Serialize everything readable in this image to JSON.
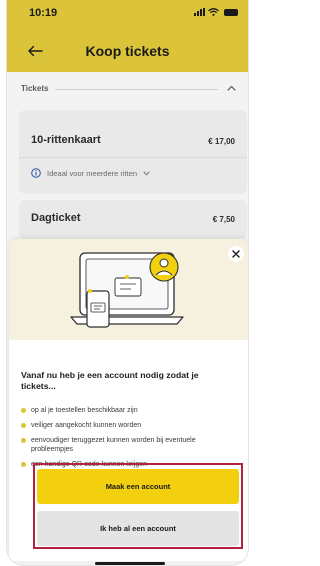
{
  "status_bar": {
    "time": "10:19"
  },
  "header": {
    "title": "Koop tickets"
  },
  "section": {
    "label": "Tickets"
  },
  "tickets": [
    {
      "name": "10-rittenkaart",
      "price": "€ 17,00",
      "info": "Ideaal voor meerdere ritten"
    },
    {
      "name": "Dagticket",
      "price": "€ 7,50"
    }
  ],
  "modal": {
    "heading": "Vanaf nu heb je een account nodig zodat je tickets...",
    "benefits": [
      "op al je toestellen beschikbaar zijn",
      "veiliger aangekocht kunnen worden",
      "eenvoudiger teruggezet kunnen worden bij eventuele probleempjes",
      "een handige QR-code kunnen krijgen"
    ],
    "primary_button": "Maak een account",
    "secondary_button": "Ik heb al een account"
  },
  "colors": {
    "brand_yellow": "#f2d00f",
    "header_yellow": "#dcc43a",
    "highlight_red": "#b42040"
  },
  "icons": [
    "back-arrow-icon",
    "chevron-up-icon",
    "info-icon",
    "chevron-down-icon",
    "close-icon",
    "signal-icon",
    "wifi-icon",
    "battery-icon"
  ]
}
